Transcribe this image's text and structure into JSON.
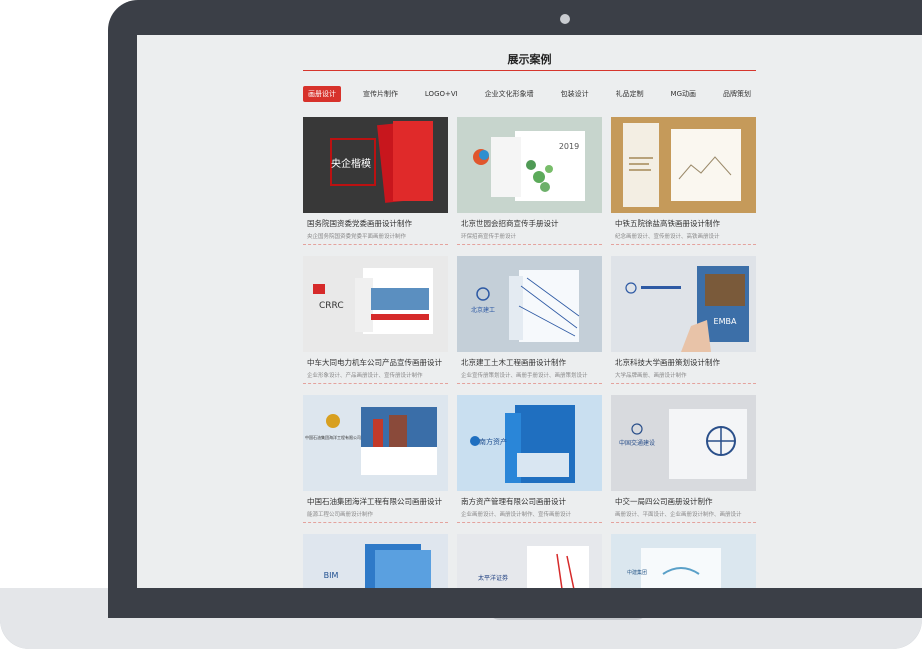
{
  "section": {
    "title": "展示案例"
  },
  "tabs": [
    {
      "label": "画册设计",
      "active": true
    },
    {
      "label": "宣传片制作",
      "active": false
    },
    {
      "label": "LOGO+VI",
      "active": false
    },
    {
      "label": "企业文化形象墙",
      "active": false
    },
    {
      "label": "包装设计",
      "active": false
    },
    {
      "label": "礼品定制",
      "active": false
    },
    {
      "label": "MG动画",
      "active": false
    },
    {
      "label": "品牌策划",
      "active": false
    }
  ],
  "cases": [
    {
      "title": "国务院国资委党委画册设计制作",
      "subtitle": "央企国务院国资委党委平面画册设计制作",
      "thumb_text": "央企楷模"
    },
    {
      "title": "北京世园会招商宣传手册设计",
      "subtitle": "环保招商宣传手册设计",
      "thumb_text": "2019"
    },
    {
      "title": "中铁五院徐盐高铁画册设计制作",
      "subtitle": "纪念画册设计、宣传册设计、高铁画册设计",
      "thumb_text": ""
    },
    {
      "title": "中车大同电力机车公司产品宣传画册设计",
      "subtitle": "企业形象设计、产品画册设计、宣传册设计制作",
      "thumb_text": "CRRC"
    },
    {
      "title": "北京建工土木工程画册设计制作",
      "subtitle": "企业宣传册策划设计、画册手册设计、画册策划设计",
      "thumb_text": "北京建工"
    },
    {
      "title": "北京科技大学画册策划设计制作",
      "subtitle": "大学品牌画册、画册设计制作",
      "thumb_text": "EMBA"
    },
    {
      "title": "中国石油集团海洋工程有限公司画册设计",
      "subtitle": "能源工程公司画册设计制作",
      "thumb_text": "中国石油集团海洋工程有限公司"
    },
    {
      "title": "南方资产管理有限公司画册设计",
      "subtitle": "企业画册设计、画册设计制作、宣传画册设计",
      "thumb_text": "南方资产"
    },
    {
      "title": "中交一局四公司画册设计制作",
      "subtitle": "画册设计、平面设计、企业画册设计制作、画册设计",
      "thumb_text": "中国交通建设"
    },
    {
      "title": "",
      "subtitle": "",
      "thumb_text": "BIM"
    },
    {
      "title": "",
      "subtitle": "",
      "thumb_text": "太平洋证券"
    },
    {
      "title": "",
      "subtitle": "",
      "thumb_text": "中建集团"
    }
  ],
  "colors": {
    "accent": "#d7322b",
    "bezel": "#3b3f47",
    "screen_bg": "#eceeef"
  }
}
